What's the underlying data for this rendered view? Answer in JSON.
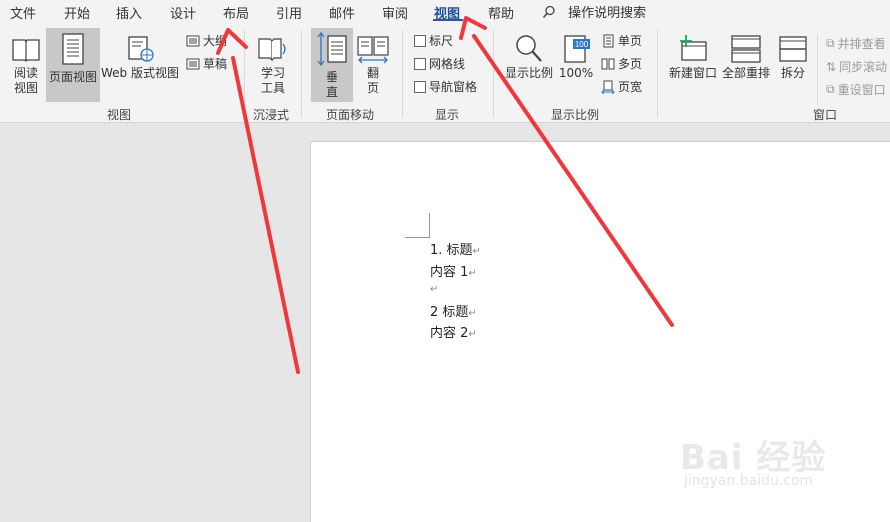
{
  "menu": {
    "items": [
      "文件",
      "开始",
      "插入",
      "设计",
      "布局",
      "引用",
      "邮件",
      "审阅",
      "视图",
      "帮助"
    ],
    "search": "操作说明搜索"
  },
  "ribbon": {
    "views": {
      "read": [
        "阅读",
        "视图"
      ],
      "print": "页面视图",
      "web": "Web 版式视图",
      "outline": "大纲",
      "draft": "草稿",
      "group": "视图"
    },
    "immersive": {
      "learn": [
        "学习",
        "工具"
      ],
      "group": "沉浸式"
    },
    "pagemove": {
      "vertical": [
        "垂",
        "直"
      ],
      "flip": [
        "翻",
        "页"
      ],
      "group": "页面移动"
    },
    "show": {
      "ruler": "标尺",
      "grid": "网格线",
      "nav": "导航窗格",
      "group": "显示"
    },
    "zoom": {
      "zoom": "显示比例",
      "hundred": "100%",
      "badge": "100",
      "one": "单页",
      "multi": "多页",
      "width": "页宽",
      "group": "显示比例"
    },
    "window": {
      "new": "新建窗口",
      "arrange": "全部重排",
      "split": "拆分",
      "side": "并排查看",
      "sync": "同步滚动",
      "reset": "重设窗口",
      "group": "窗口"
    }
  },
  "document": {
    "lines": [
      "1. 标题",
      "内容 1",
      "",
      "2 标题",
      "内容 2"
    ],
    "para_mark": "↵"
  },
  "watermark": {
    "brand": "Bai 经验",
    "url": "jingyan.baidu.com"
  },
  "colors": {
    "accent": "#2b579a",
    "arrow": "#f0373b"
  }
}
